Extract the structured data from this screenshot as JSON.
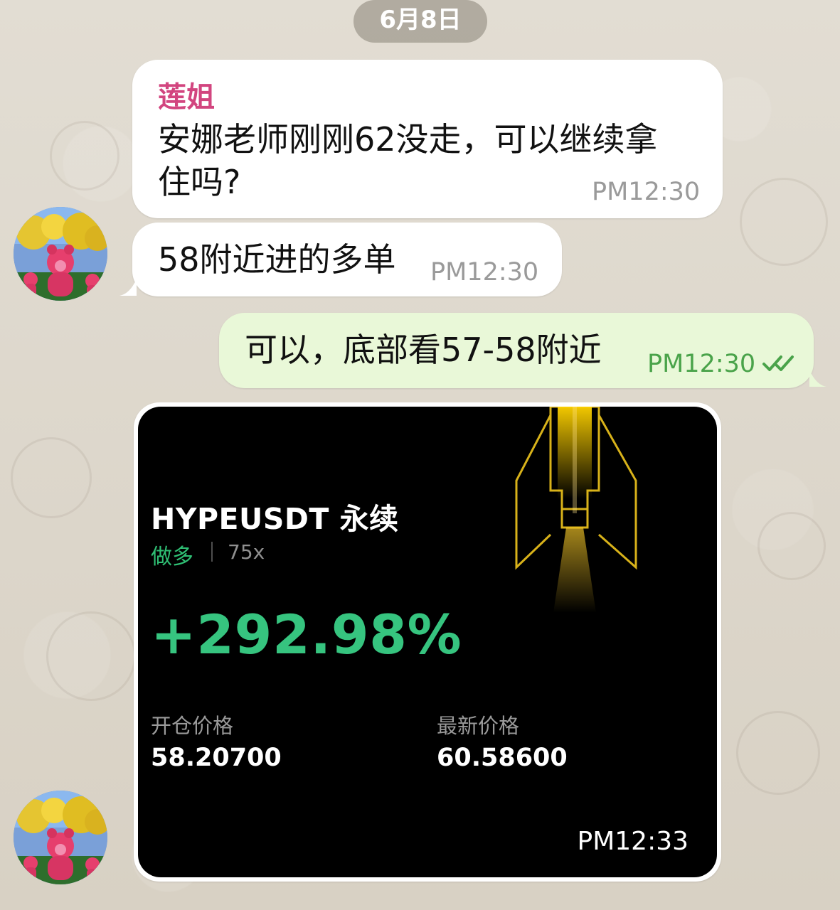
{
  "chat": {
    "date": "6月8日",
    "messages": [
      {
        "sender": "莲姐",
        "text_line1": "安娜老师刚刚62没走，可以继续拿",
        "text_line2": "住吗?",
        "time": "PM12:30"
      },
      {
        "text": "58附近进的多单",
        "time": "PM12:30"
      },
      {
        "text": "可以，底部看57-58附近",
        "time": "PM12:30"
      }
    ],
    "trade_card": {
      "symbol": "HYPEUSDT 永续",
      "side": "做多",
      "leverage": "75x",
      "pnl": "+292.98%",
      "open_price_label": "开仓价格",
      "open_price": "58.20700",
      "latest_price_label": "最新价格",
      "latest_price": "60.58600",
      "time": "PM12:33"
    }
  },
  "colors": {
    "sender_name": "#d2457f",
    "outgoing_time": "#4aa34a",
    "profit": "#36c47f",
    "bubble_out": "#e9f8d8",
    "card_bg": "#000000"
  },
  "icons": {
    "read_receipt": "double-check-icon",
    "avatar": "strawberry-bear-avatar"
  }
}
